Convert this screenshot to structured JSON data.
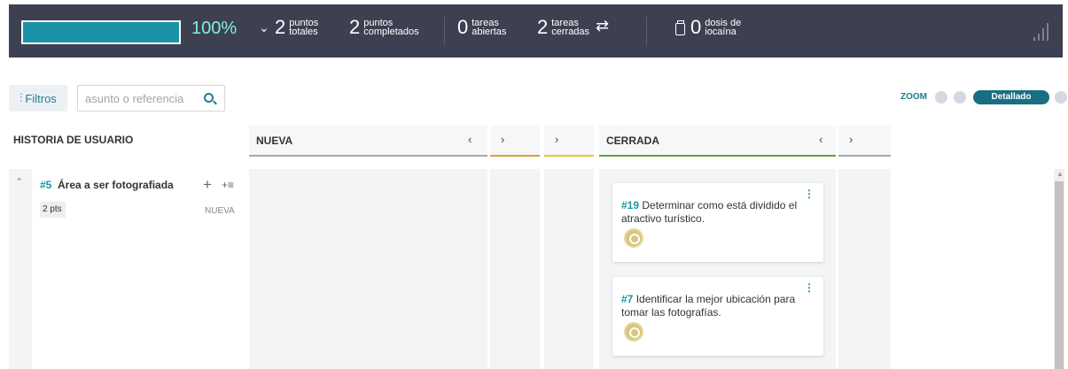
{
  "stats": {
    "progress_percent": 100,
    "percent_label": "100%",
    "total_points": {
      "value": "2",
      "label": "puntos\ntotales"
    },
    "completed_points": {
      "value": "2",
      "label": "puntos\ncompletados"
    },
    "open_tasks": {
      "value": "0",
      "label": "tareas\nabiertas"
    },
    "closed_tasks": {
      "value": "2",
      "label": "tareas\ncerradas"
    },
    "iocaine": {
      "value": "0",
      "label": "dosis de\niocaína"
    }
  },
  "toolbar": {
    "filters_label": "Filtros",
    "search_placeholder": "asunto o referencia",
    "zoom_label": "ZOOM",
    "zoom_selected": "Detallado"
  },
  "board": {
    "user_story_header": "HISTORIA DE USUARIO",
    "columns": [
      {
        "title": "NUEVA",
        "color": "#a8a8a8"
      },
      {
        "title": "",
        "color": "#e89b2f"
      },
      {
        "title": "",
        "color": "#e7c634"
      },
      {
        "title": "CERRADA",
        "color": "#5fa133"
      },
      {
        "title": "",
        "color": "#a8a8a8"
      }
    ],
    "user_story": {
      "ref": "#5",
      "title": "Área a ser fotografiada",
      "points": "2 pts",
      "status": "NUEVA"
    },
    "tasks": [
      {
        "ref": "#19",
        "title": "Determinar como está dividido el atractivo turístico."
      },
      {
        "ref": "#7",
        "title": "Identificar la mejor ubicación para tomar las fotografías."
      }
    ]
  }
}
